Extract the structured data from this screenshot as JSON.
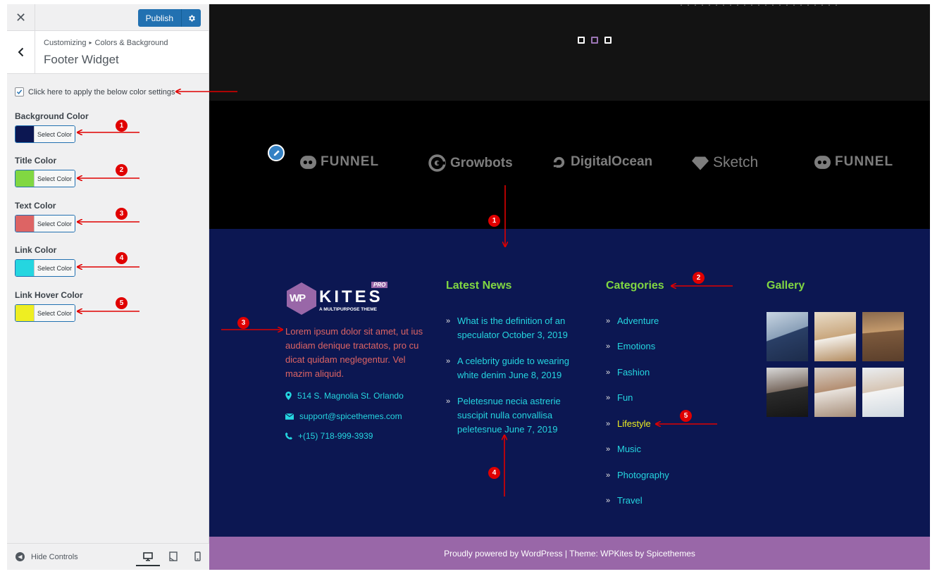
{
  "topbar": {
    "close_symbol": "✕",
    "publish_label": "Publish"
  },
  "section": {
    "breadcrumb_root": "Customizing",
    "breadcrumb_sep": "▸",
    "breadcrumb_parent": "Colors & Background",
    "title": "Footer Widget"
  },
  "apply": {
    "label": "Click here to apply the below color settings",
    "checked": true
  },
  "controls": [
    {
      "label": "Background Color",
      "color": "#0c1752",
      "button": "Select Color"
    },
    {
      "label": "Title Color",
      "color": "#81d742",
      "button": "Select Color"
    },
    {
      "label": "Text Color",
      "color": "#dd6464",
      "button": "Select Color"
    },
    {
      "label": "Link Color",
      "color": "#25d6e0",
      "button": "Select Color"
    },
    {
      "label": "Link Hover Color",
      "color": "#eeee22",
      "button": "Select Color"
    }
  ],
  "sidebar_footer": {
    "hide_controls": "Hide Controls"
  },
  "sponsors": [
    "FUNNEL",
    "Growbots",
    "DigitalOcean",
    "Sketch",
    "FUNNEL"
  ],
  "footer": {
    "logo": {
      "mark": "WP",
      "name": "KITES",
      "badge": "PRO",
      "tagline": "A MULTIPURPOSE THEME"
    },
    "about": "Lorem ipsum dolor sit amet, ut ius audiam denique tractatos, pro cu dicat quidam neglegentur. Vel mazim aliquid.",
    "address": "514 S. Magnolia St. Orlando",
    "email": "support@spicethemes.com",
    "phone": "+(15) 718-999-3939",
    "news_title": "Latest News",
    "news": [
      {
        "text": "What is the definition of an speculator",
        "date": "October 3, 2019"
      },
      {
        "text": "A celebrity guide to wearing white denim",
        "date": "June 8, 2019"
      },
      {
        "text": "Peletesnue necia astrerie suscipit nulla convallisa peletesnue",
        "date": "June 7, 2019"
      }
    ],
    "categories_title": "Categories",
    "categories": [
      "Adventure",
      "Emotions",
      "Fashion",
      "Fun",
      "Lifestyle",
      "Music",
      "Photography",
      "Travel"
    ],
    "gallery_title": "Gallery",
    "copyright": "Proudly powered by WordPress | Theme: WPKites by Spicethemes"
  },
  "annotations": [
    "1",
    "2",
    "3",
    "4",
    "5"
  ],
  "colors": {
    "accent": "#2271b1",
    "copyright_bg": "#9967a8",
    "sponsor_bg": "#000000",
    "annotation": "#e00000"
  }
}
